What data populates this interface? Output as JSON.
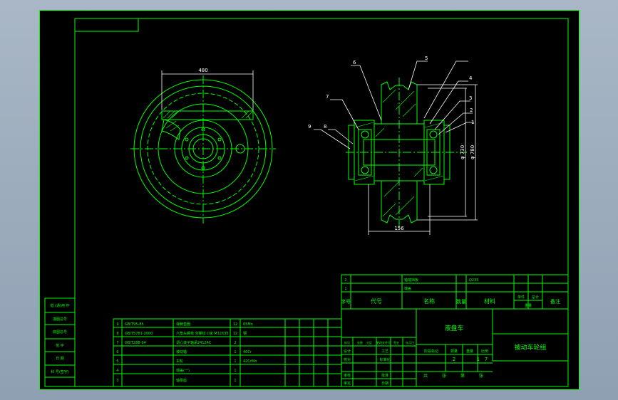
{
  "drawing": {
    "colors": {
      "background": "#000000",
      "line": "#00ff00",
      "dimension": "#ffffff",
      "app_frame": "#a9b7c6"
    },
    "left_view": {
      "width_dim": "480"
    },
    "section_view": {
      "bottom_dim": "156",
      "dia_1": "φ 730",
      "dia_2": "φ 780"
    },
    "callouts": [
      "1",
      "2",
      "3",
      "4",
      "5",
      "6",
      "7",
      "8",
      "9"
    ],
    "side_columns": [
      "借 (通)用 件",
      "描图总号",
      "底图总号",
      "签 字",
      "日 期",
      "科 号(签字)"
    ],
    "parts_list": [
      {
        "no": "9",
        "code": "GB/T95-85",
        "name": "弹簧垫圈",
        "qty": "12",
        "mat": "65Mn"
      },
      {
        "no": "8",
        "code": "GB/T5781-2000",
        "name": "六角头螺栓 全螺纹 C级 M12X35",
        "qty": "12",
        "mat": "钢"
      },
      {
        "no": "7",
        "code": "GB/T288-94",
        "name": "调心滚子轴承24124C",
        "qty": "2",
        "mat": ""
      },
      {
        "no": "6",
        "code": "",
        "name": "被动轴",
        "qty": "1",
        "mat": "40Cr"
      },
      {
        "no": "5",
        "code": "",
        "name": "车轮",
        "qty": "1",
        "mat": "42CrMo"
      },
      {
        "no": "4",
        "code": "",
        "name": "端盖(一)",
        "qty": "1",
        "mat": ""
      },
      {
        "no": "3",
        "code": "",
        "name": "轴承座",
        "qty": "1",
        "mat": ""
      }
    ],
    "title_block": {
      "row2": {
        "no": "2",
        "name": "轴端挡板",
        "code2": "Q235"
      },
      "row1": {
        "no": "1",
        "name": "端盖"
      },
      "headers": {
        "no": "序号",
        "code": "代号",
        "name": "名称",
        "qty": "数量",
        "mat": "材料",
        "unit_wt": "单件",
        "total_wt": "总计",
        "weight": "重量",
        "remark": "备注"
      },
      "company": "液盘车",
      "drawing_title": "被动车轮组",
      "sign_rows": [
        "标记",
        "设计",
        "校对",
        "审核",
        "审定"
      ],
      "sign_head": [
        "处数",
        "分区",
        "更改文件号",
        "签名",
        "年月日"
      ],
      "sign_right": [
        "工艺",
        "标准化",
        "批准",
        "日期"
      ],
      "stage_head": [
        "阶段标记",
        "数量",
        "重量",
        "比例"
      ],
      "stage_vals": [
        "2",
        "1",
        "7"
      ],
      "sheet_text": [
        "共",
        "张",
        "第",
        "张"
      ]
    }
  }
}
